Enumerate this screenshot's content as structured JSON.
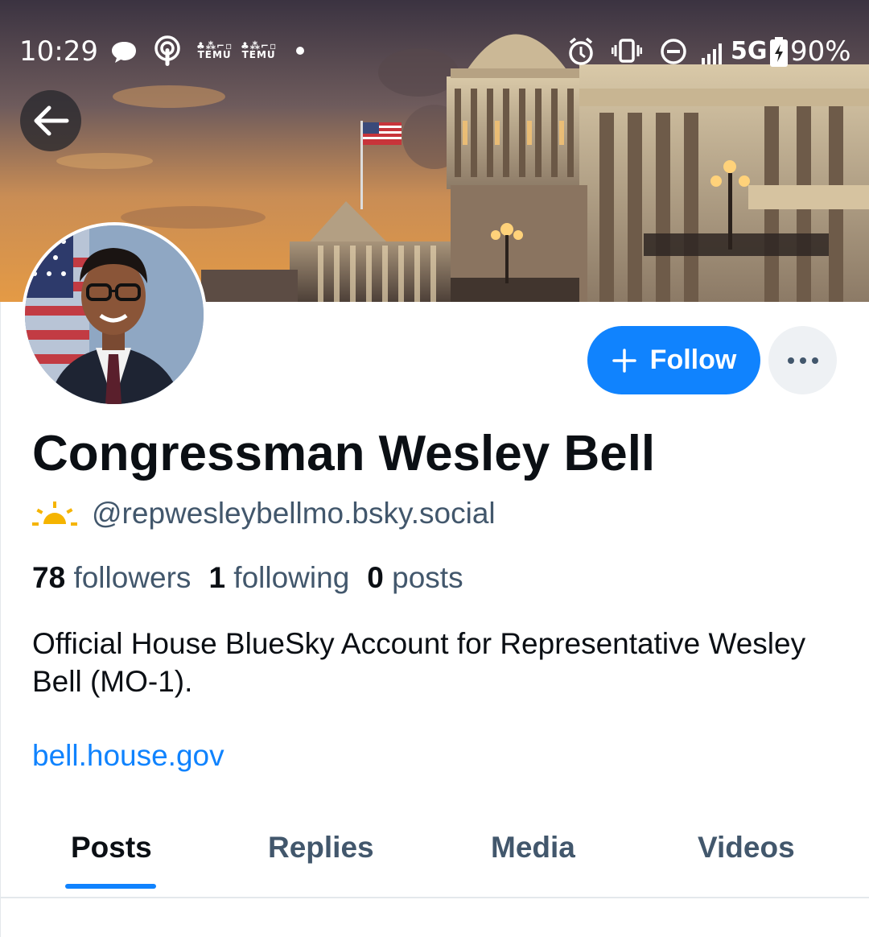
{
  "status_bar": {
    "time": "10:29",
    "notification_icons": [
      "chat-bubble-icon",
      "podcast-icon",
      "temu-icon",
      "temu-icon"
    ],
    "temu_label": "TEMU",
    "network": "5G",
    "battery": "90%",
    "system_icons": [
      "alarm-icon",
      "vibrate-icon",
      "do-not-disturb-icon",
      "signal-icon",
      "battery-charging-icon"
    ]
  },
  "header": {
    "back_icon": "arrow-left-icon"
  },
  "profile": {
    "display_name": "Congressman Wesley Bell",
    "handle": "@repwesleybellmo.bsky.social",
    "handle_badge_icon": "sun-icon",
    "followers_count": "78",
    "followers_label": "followers",
    "following_count": "1",
    "following_label": "following",
    "posts_count": "0",
    "posts_label": "posts",
    "bio": "Official House BlueSky Account for Representative Wesley Bell (MO-1).",
    "website": "bell.house.gov"
  },
  "actions": {
    "follow_label": "Follow",
    "follow_icon": "plus-icon",
    "more_icon": "ellipsis-icon"
  },
  "tabs": [
    {
      "label": "Posts",
      "active": true
    },
    {
      "label": "Replies",
      "active": false
    },
    {
      "label": "Media",
      "active": false
    },
    {
      "label": "Videos",
      "active": false
    }
  ],
  "colors": {
    "accent": "#1083fe",
    "text_primary": "#0b0f14",
    "text_secondary": "#42576c",
    "badge_sun": "#f5b400"
  }
}
